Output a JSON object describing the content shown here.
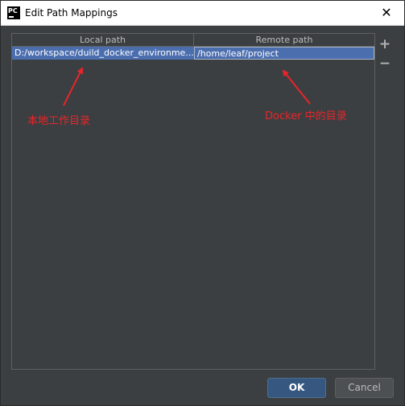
{
  "window": {
    "title": "Edit Path Mappings",
    "app_icon_text": "PC",
    "close_glyph": "✕"
  },
  "table": {
    "columns": [
      "Local path",
      "Remote path"
    ],
    "rows": [
      {
        "local": "D:/workspace/duild_docker_environme...",
        "remote": "/home/leaf/project",
        "selected": true
      }
    ]
  },
  "toolbar": {
    "add_label": "+",
    "remove_label": "−"
  },
  "annotations": {
    "local_label": "本地工作目录",
    "remote_label": "Docker 中的目录",
    "color": "#e8252a"
  },
  "buttons": {
    "ok_label": "OK",
    "cancel_label": "Cancel"
  },
  "colors": {
    "background": "#3c3f41",
    "selection": "#4b6eaf",
    "ok_button": "#365880"
  },
  "icons": {
    "app": "pycharm-icon",
    "close": "close-icon",
    "add": "plus-icon",
    "remove": "minus-icon"
  }
}
